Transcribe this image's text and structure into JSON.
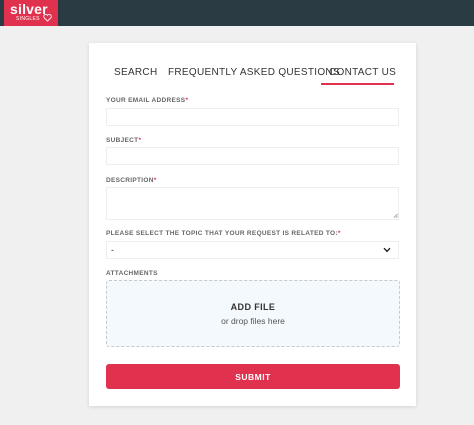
{
  "brand": {
    "logo_word": "silver",
    "logo_sub": "SINGLES",
    "logo_bg": "#e0324e",
    "topbar_bg": "#2b3b44"
  },
  "tabs": [
    {
      "label": "SEARCH",
      "active": false
    },
    {
      "label": "FREQUENTLY ASKED QUESTIONS",
      "active": false
    },
    {
      "label": "CONTACT US",
      "active": true
    }
  ],
  "form": {
    "email": {
      "label": "YOUR EMAIL ADDRESS",
      "required_mark": "*",
      "value": ""
    },
    "subject": {
      "label": "SUBJECT",
      "required_mark": "*",
      "value": ""
    },
    "description": {
      "label": "DESCRIPTION",
      "required_mark": "*",
      "value": ""
    },
    "topic": {
      "label": "PLEASE SELECT THE TOPIC THAT YOUR REQUEST IS RELATED TO:",
      "required_mark": "*",
      "selected": "-"
    },
    "attachments": {
      "label": "ATTACHMENTS",
      "add_file": "ADD FILE",
      "drop_hint": "or drop files here"
    },
    "submit_label": "SUBMIT"
  },
  "colors": {
    "accent": "#e0324e",
    "dropzone_bg": "#f3f9fc"
  },
  "icons": [
    "heart-icon",
    "chevron-down-icon",
    "resize-grip-icon"
  ]
}
